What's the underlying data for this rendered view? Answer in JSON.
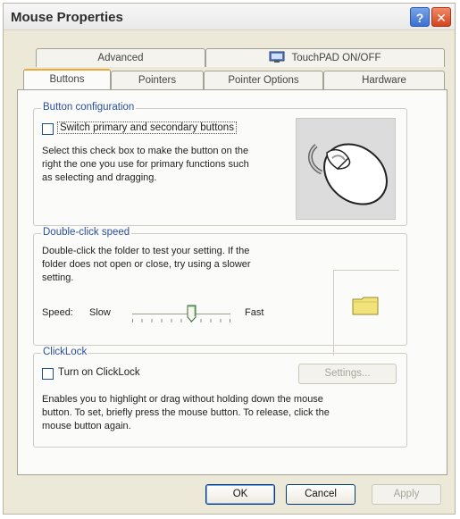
{
  "window": {
    "title": "Mouse Properties"
  },
  "titlebar_buttons": {
    "help": "?",
    "close": "✕"
  },
  "tabs_top": [
    {
      "label": "Advanced"
    },
    {
      "label": "TouchPAD ON/OFF",
      "icon": "touchpad-icon"
    }
  ],
  "tabs_bottom": [
    {
      "label": "Buttons",
      "active": true
    },
    {
      "label": "Pointers"
    },
    {
      "label": "Pointer Options"
    },
    {
      "label": "Hardware"
    }
  ],
  "button_config": {
    "title": "Button configuration",
    "checkbox_label": "Switch primary and secondary buttons",
    "checked": false,
    "desc_line1": "Select this check box to make the button on the",
    "desc_line2": "right the one you use for primary functions such",
    "desc_line3": "as selecting and dragging.",
    "image": "mouse-icon"
  },
  "double_click": {
    "title": "Double-click speed",
    "desc_line1": "Double-click the folder to test your setting. If the",
    "desc_line2": "folder does not open or close, try using a slower",
    "desc_line3": "setting.",
    "speed_label": "Speed:",
    "slow_label": "Slow",
    "fast_label": "Fast",
    "slider_value": 0.6,
    "test_icon": "folder-icon"
  },
  "clicklock": {
    "title": "ClickLock",
    "checkbox_label": "Turn on ClickLock",
    "checked": false,
    "settings_button": "Settings...",
    "desc_line1": "Enables you to highlight or drag without holding down the mouse",
    "desc_line2": "button. To set, briefly press the mouse button. To release, click the",
    "desc_line3": "mouse button again."
  },
  "footer": {
    "ok": "OK",
    "cancel": "Cancel",
    "apply": "Apply"
  },
  "colors": {
    "accent_tab": "#f0a534",
    "group_title": "#2a4f9e",
    "folder": "#f2e27a"
  }
}
